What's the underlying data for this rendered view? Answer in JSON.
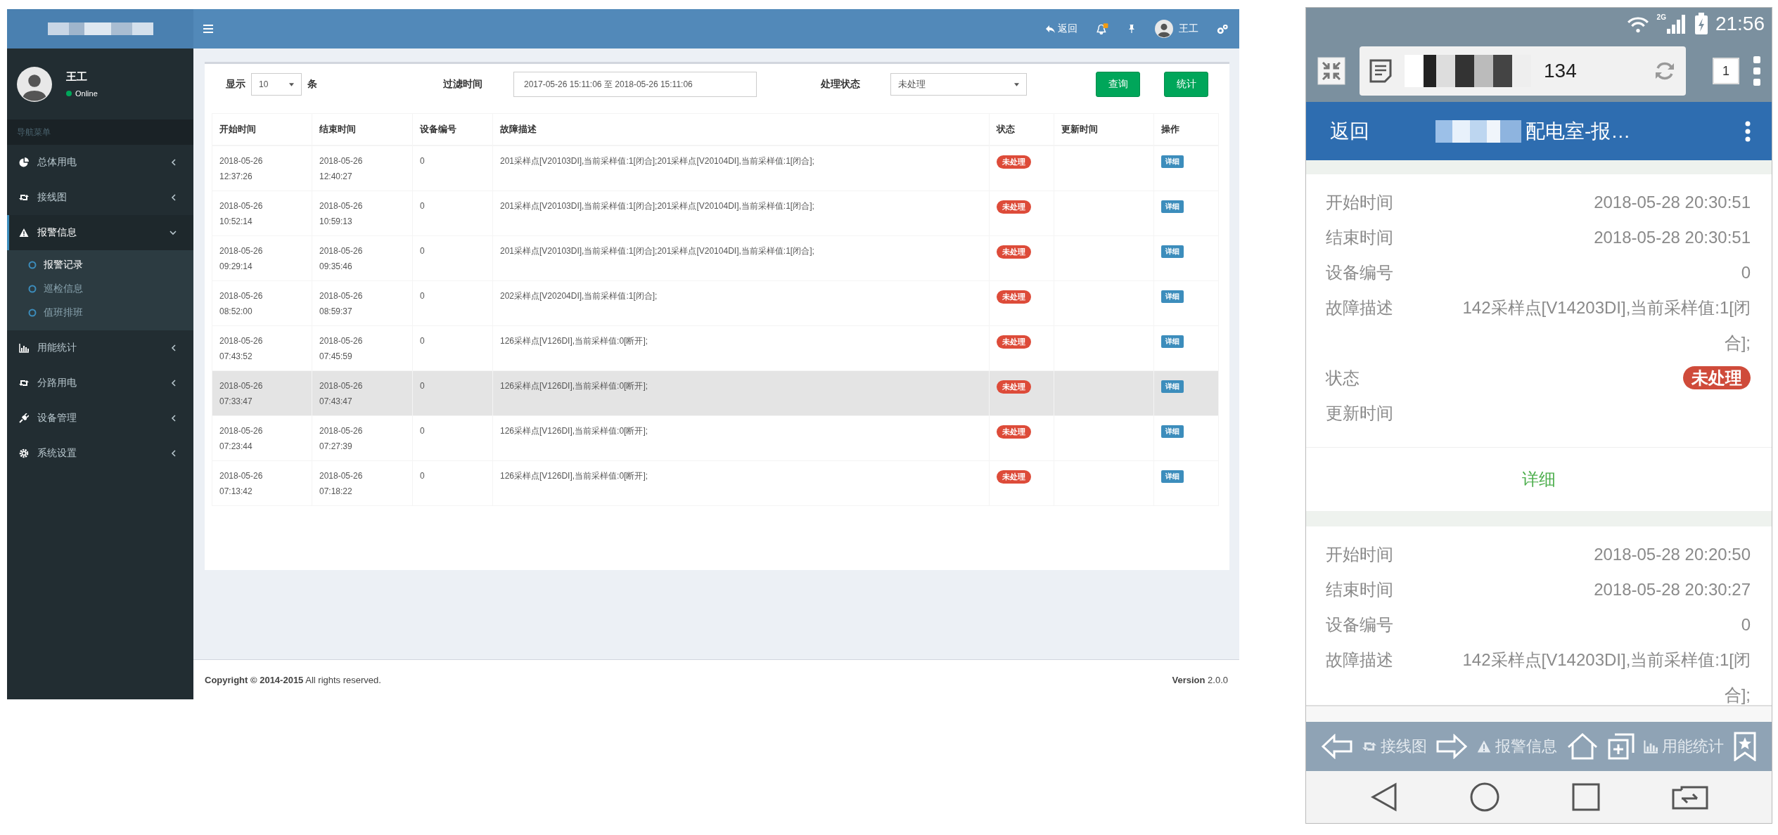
{
  "admin": {
    "topbar": {
      "back_label": "返回",
      "user_name": "王工"
    },
    "user_panel": {
      "name": "王工",
      "status": "Online"
    },
    "sidebar": {
      "header": "导航菜单",
      "items": [
        {
          "label": "总体用电",
          "expanded": false,
          "selected": false
        },
        {
          "label": "接线图",
          "expanded": false,
          "selected": false
        },
        {
          "label": "报警信息",
          "expanded": true,
          "selected": true,
          "children": [
            {
              "label": "报警记录",
              "selected": true
            },
            {
              "label": "巡检信息",
              "selected": false
            },
            {
              "label": "值班排班",
              "selected": false
            }
          ]
        },
        {
          "label": "用能统计",
          "expanded": false,
          "selected": false
        },
        {
          "label": "分路用电",
          "expanded": false,
          "selected": false
        },
        {
          "label": "设备管理",
          "expanded": false,
          "selected": false
        },
        {
          "label": "系统设置",
          "expanded": false,
          "selected": false
        }
      ]
    },
    "filters": {
      "show_label": "显示",
      "page_size": "10",
      "rows_label": "条",
      "time_label": "过滤时间",
      "time_range": "2017-05-26 15:11:06 至 2018-05-26 15:11:06",
      "status_label": "处理状态",
      "status_value": "未处理",
      "buttons": [
        "查询",
        "统计"
      ]
    },
    "table": {
      "columns": [
        "开始时间",
        "结束时间",
        "设备编号",
        "故障描述",
        "状态",
        "更新时间",
        "操作"
      ],
      "rows": [
        {
          "start": "2018-05-26 12:37:26",
          "end": "2018-05-26 12:40:27",
          "device": "0",
          "description": "201采样点[V20103DI],当前采样值:1[闭合];201采样点[V20104DI],当前采样值:1[闭合];",
          "status": "未处理",
          "action": "详细",
          "highlighted": false
        },
        {
          "start": "2018-05-26 10:52:14",
          "end": "2018-05-26 10:59:13",
          "device": "0",
          "description": "201采样点[V20103DI],当前采样值:1[闭合];201采样点[V20104DI],当前采样值:1[闭合];",
          "status": "未处理",
          "action": "详细",
          "highlighted": false
        },
        {
          "start": "2018-05-26 09:29:14",
          "end": "2018-05-26 09:35:46",
          "device": "0",
          "description": "201采样点[V20103DI],当前采样值:1[闭合];201采样点[V20104DI],当前采样值:1[闭合];",
          "status": "未处理",
          "action": "详细",
          "highlighted": false
        },
        {
          "start": "2018-05-26 08:52:00",
          "end": "2018-05-26 08:59:37",
          "device": "0",
          "description": "202采样点[V20204DI],当前采样值:1[闭合];",
          "status": "未处理",
          "action": "详细",
          "highlighted": false
        },
        {
          "start": "2018-05-26 07:43:52",
          "end": "2018-05-26 07:45:59",
          "device": "0",
          "description": "126采样点[V126DI],当前采样值:0[断开];",
          "status": "未处理",
          "action": "详细",
          "highlighted": false
        },
        {
          "start": "2018-05-26 07:33:47",
          "end": "2018-05-26 07:43:47",
          "device": "0",
          "description": "126采样点[V126DI],当前采样值:0[断开];",
          "status": "未处理",
          "action": "详细",
          "highlighted": true
        },
        {
          "start": "2018-05-26 07:23:44",
          "end": "2018-05-26 07:27:39",
          "device": "0",
          "description": "126采样点[V126DI],当前采样值:0[断开];",
          "status": "未处理",
          "action": "详细",
          "highlighted": false
        },
        {
          "start": "2018-05-26 07:13:42",
          "end": "2018-05-26 07:18:22",
          "device": "0",
          "description": "126采样点[V126DI],当前采样值:0[断开];",
          "status": "未处理",
          "action": "详细",
          "highlighted": false
        }
      ]
    },
    "footer": {
      "copyright": "**Copyright © 2014-2015** All rights reserved.",
      "version": "**Version** 2.0.0"
    }
  },
  "phone": {
    "status_bar": {
      "network": "2G",
      "time": "21:56"
    },
    "browser": {
      "url_tail": "134",
      "tab_count": "1"
    },
    "app_bar": {
      "back": "返回",
      "title": "配电室-报…"
    },
    "records": [
      {
        "fields": [
          {
            "label": "开始时间",
            "value": "2018-05-28 20:30:51",
            "kind": "text"
          },
          {
            "label": "结束时间",
            "value": "2018-05-28 20:30:51",
            "kind": "text"
          },
          {
            "label": "设备编号",
            "value": "0",
            "kind": "text"
          },
          {
            "label": "故障描述",
            "value": "142采样点[V14203DI],当前采样值:1[闭合];",
            "kind": "text"
          },
          {
            "label": "状态",
            "value": "未处理",
            "kind": "badge"
          },
          {
            "label": "更新时间",
            "kind": "text"
          }
        ],
        "action": "详细"
      },
      {
        "fields": [
          {
            "label": "开始时间",
            "value": "2018-05-28 20:20:50",
            "kind": "text"
          },
          {
            "label": "结束时间",
            "value": "2018-05-28 20:30:27",
            "kind": "text"
          },
          {
            "label": "设备编号",
            "value": "0",
            "kind": "text"
          },
          {
            "label": "故障描述",
            "value": "142采样点[V14203DI],当前采样值:1[闭合];",
            "kind": "text"
          }
        ]
      }
    ],
    "tabs": [
      "接线图",
      "报警信息",
      "用能统计"
    ]
  }
}
